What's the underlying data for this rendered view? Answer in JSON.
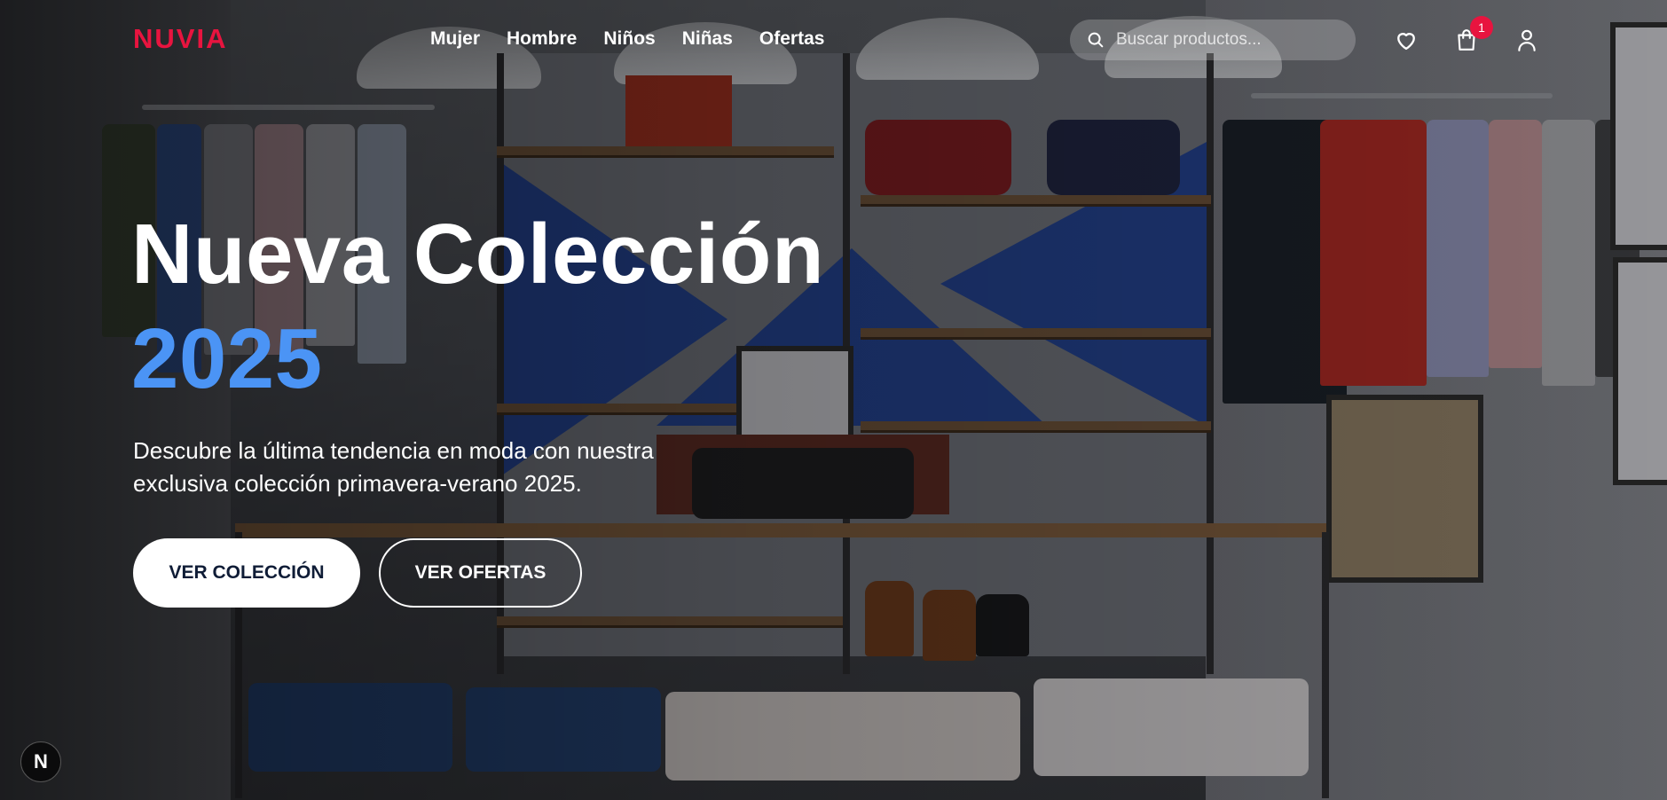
{
  "brand": {
    "logo": "NUVIA",
    "accent_color": "#e8143f"
  },
  "nav": {
    "items": [
      {
        "label": "Mujer"
      },
      {
        "label": "Hombre"
      },
      {
        "label": "Niños"
      },
      {
        "label": "Niñas"
      },
      {
        "label": "Ofertas"
      }
    ]
  },
  "search": {
    "placeholder": "Buscar productos...",
    "value": "",
    "icon": "search-icon"
  },
  "header_actions": {
    "wishlist_icon": "heart-icon",
    "cart_icon": "shopping-bag-icon",
    "cart_count": "1",
    "account_icon": "user-icon"
  },
  "hero": {
    "title_line1": "Nueva Colección",
    "title_line2": "2025",
    "title_accent_color": "#4b94f5",
    "subtitle": "Descubre la última tendencia en moda con nuestra exclusiva colección primavera-verano 2025.",
    "primary_cta": "VER COLECCIÓN",
    "secondary_cta": "VER OFERTAS"
  },
  "dev_badge": {
    "label": "N"
  }
}
